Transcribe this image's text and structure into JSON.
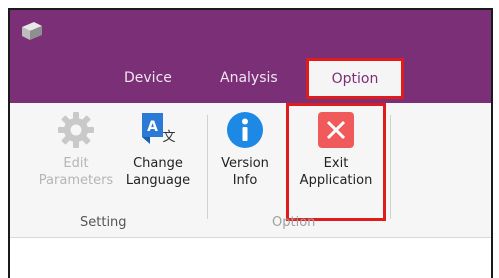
{
  "tabs": {
    "device": "Device",
    "analysis": "Analysis",
    "option": "Option"
  },
  "ribbon": {
    "setting_group": {
      "label": "Setting",
      "edit_parameters": {
        "line1": "Edit",
        "line2": "Parameters",
        "icon": "gear-icon",
        "enabled": false
      },
      "change_language": {
        "line1": "Change",
        "line2": "Language",
        "icon": "translate-icon"
      }
    },
    "option_group": {
      "label": "Option",
      "version_info": {
        "line1": "Version",
        "line2": "Info",
        "icon": "info-icon"
      },
      "exit_application": {
        "line1": "Exit",
        "line2": "Application",
        "icon": "close-icon"
      }
    }
  },
  "colors": {
    "titlebar": "#7a2f77",
    "highlight": "#e01b1b",
    "info_blue": "#1e88e5",
    "exit_red": "#f05a5a"
  }
}
